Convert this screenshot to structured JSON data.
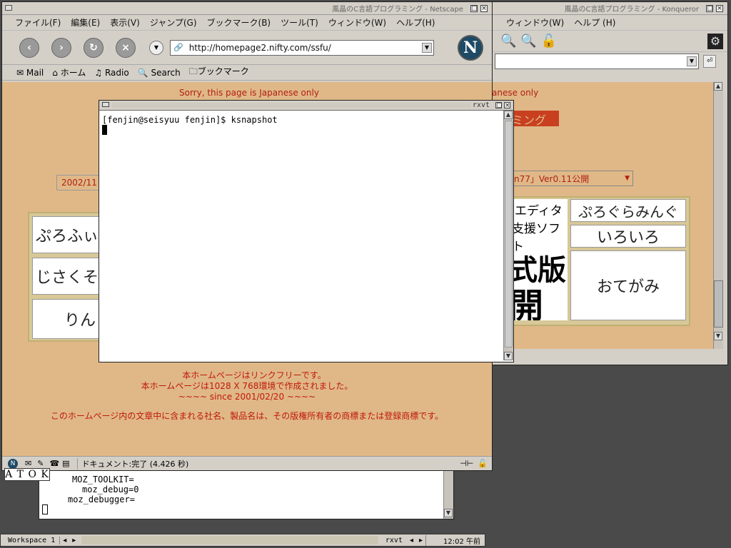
{
  "konqueror": {
    "title": "風晶のC言語プログラミング - Konqueror",
    "menu": [
      "ウィンドウ(W)",
      "ヘルプ (H)"
    ],
    "sorry_text": "anese only",
    "banner_text": "ミング",
    "dropdown_text": "n77」Ver0.11公開",
    "panels": {
      "editor1": "エディタ",
      "editor2": "支援ソフト",
      "big1": "式版",
      "big2": "開始",
      "programming": "ぷろぐらみんぐ",
      "misc": "いろいろ",
      "letters": "おてがみ"
    }
  },
  "netscape": {
    "title": "風晶のC言語プログラミング - Netscape",
    "menu": [
      "ファイル(F)",
      "編集(E)",
      "表示(V)",
      "ジャンプ(G)",
      "ブックマーク(B)",
      "ツール(T)",
      "ウィンドウ(W)",
      "ヘルプ(H)"
    ],
    "url": "http://homepage2.nifty.com/ssfu/",
    "personal_bar": [
      "Mail",
      "ホーム",
      "Radio",
      "Search",
      "ブックマーク"
    ],
    "sorry_text": "Sorry, this page is Japanese only",
    "date_box": "2002/11",
    "panels": {
      "profile": "ぷろふぃ",
      "self_intro": "じさくそ",
      "links": "りん"
    },
    "footer": {
      "line1": "本ホームページはリンクフリーです。",
      "line2": "本ホームページは1028 X 768環境で作成されました。",
      "line3": "~~~~  since 2001/02/20  ~~~~",
      "line4": "このホームページ内の文章中に含まれる社名、製品名は、その版権所有者の商標または登録商標です。"
    },
    "status": "ドキュメント:完了 (4.426 秒)"
  },
  "rxvt_front": {
    "title": "rxvt",
    "prompt_line": "[fenjin@seisyuu fenjin]$ ksnapshot"
  },
  "rxvt_back": {
    "lines": [
      "MOZ_TOOLKIT=",
      "moz_debug=0",
      "moz_debugger="
    ]
  },
  "atok": {
    "label": "A T O K"
  },
  "taskbar": {
    "workspace": "Workspace 1",
    "task": "rxvt",
    "clock": "12:02 午前"
  },
  "colors": {
    "page_bg": "#e0b888",
    "red_text": "#c01808",
    "desktop": "#4a4a4a"
  }
}
